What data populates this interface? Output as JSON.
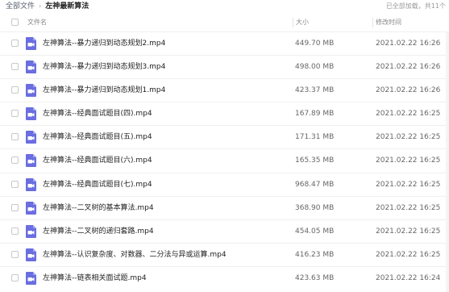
{
  "breadcrumb": {
    "root": "全部文件",
    "separator": "›",
    "current": "左神最新算法"
  },
  "load_status": "已全部加载，共11个",
  "columns": {
    "name": "文件名",
    "size": "大小",
    "time": "修改时间"
  },
  "colors": {
    "file_icon": "#6a6ee0"
  },
  "files": [
    {
      "icon": "video-file-icon",
      "name": "左神算法--暴力递归到动态规划2.mp4",
      "size": "449.70 MB",
      "time": "2021.02.22 16:26"
    },
    {
      "icon": "video-file-icon",
      "name": "左神算法--暴力递归到动态规划3.mp4",
      "size": "498.00 MB",
      "time": "2021.02.22 16:26"
    },
    {
      "icon": "video-file-icon",
      "name": "左神算法--暴力递归到动态规划1.mp4",
      "size": "423.37 MB",
      "time": "2021.02.22 16:26"
    },
    {
      "icon": "video-file-icon",
      "name": "左神算法--经典面试题目(四).mp4",
      "size": "167.89 MB",
      "time": "2021.02.22 16:25"
    },
    {
      "icon": "video-file-icon",
      "name": "左神算法--经典面试题目(五).mp4",
      "size": "171.31 MB",
      "time": "2021.02.22 16:25"
    },
    {
      "icon": "video-file-icon",
      "name": "左神算法--经典面试题目(六).mp4",
      "size": "165.35 MB",
      "time": "2021.02.22 16:25"
    },
    {
      "icon": "video-file-icon",
      "name": "左神算法--经典面试题目(七).mp4",
      "size": "968.47 MB",
      "time": "2021.02.22 16:25"
    },
    {
      "icon": "video-file-icon",
      "name": "左神算法--二叉树的基本算法.mp4",
      "size": "368.90 MB",
      "time": "2021.02.22 16:25"
    },
    {
      "icon": "video-file-icon",
      "name": "左神算法--二叉树的递归套路.mp4",
      "size": "454.05 MB",
      "time": "2021.02.22 16:25"
    },
    {
      "icon": "video-file-icon",
      "name": "左神算法--认识复杂度、对数器、二分法与异或运算.mp4",
      "size": "416.23 MB",
      "time": "2021.02.22 16:25"
    },
    {
      "icon": "video-file-icon",
      "name": "左神算法--链表相关面试题.mp4",
      "size": "423.63 MB",
      "time": "2021.02.22 16:24"
    }
  ]
}
